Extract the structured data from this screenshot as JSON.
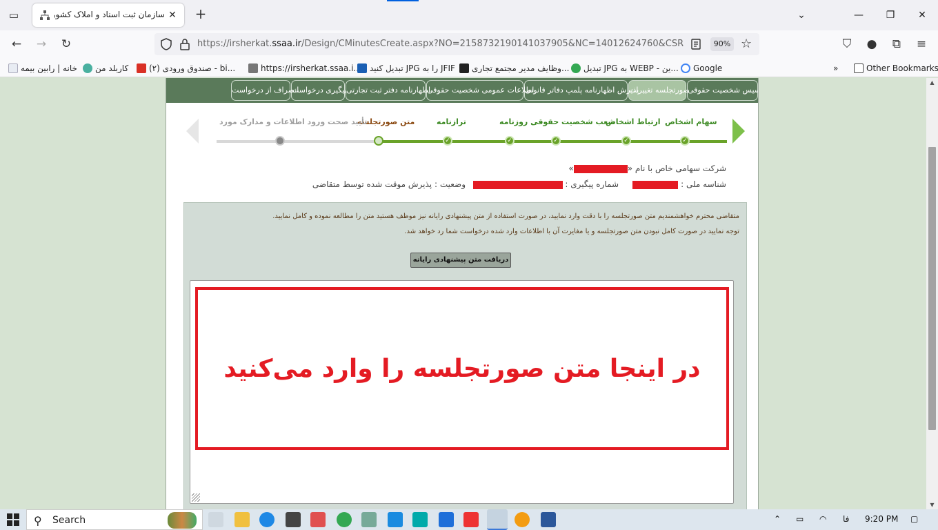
{
  "browser": {
    "tab_title": "سازمان ثبت اسناد و املاک کشور",
    "url_prefix": "https://irsherkat.",
    "url_domain": "ssaa.ir",
    "url_rest": "/Design/CMinutesCreate.aspx?NO=2158732190141037905&NC=14012624760&CSRF=0a",
    "zoom": "90%",
    "bookmarks": [
      "خانه | رابین بیمه",
      "کاربلد من",
      "(۲) صندوق ورودی - bi...",
      "https://irsherkat.ssaa.i...",
      "تبدیل کنید JPG را به JFIF",
      "وظایف مدیر مجتمع تجاری...",
      "تبدیل JPG به WEBP - ین...",
      "Google"
    ],
    "other_bookmarks": "Other Bookmarks"
  },
  "menu": [
    "تأسیس شخصیت حقوقی",
    "صورتجلسه تغییرات",
    "پذیرش اظهارنامه پلمپ دفاتر قانونی",
    "اطلاعات عمومی شخصیت حقوقی",
    "اظهارنامه دفتر ثبت تجارتی",
    "پیگیری درخواست",
    "انصراف از درخواست"
  ],
  "steps": [
    {
      "label": "سهام اشخاص",
      "state": "done"
    },
    {
      "label": "ارتباط اشخاص",
      "state": "done"
    },
    {
      "label": "شعب شخصیت حقوقی روزنامه",
      "state": "done"
    },
    {
      "label": "ترازنامه",
      "state": "done"
    },
    {
      "label": "متن صورتجلسه",
      "state": "current"
    },
    {
      "label": "تأیید صحت ورود اطلاعات و مدارک مورد",
      "state": "todo"
    }
  ],
  "company": {
    "prefix": "شرکت سهامی خاص با نام «",
    "suffix": "»",
    "national_id_label": "شناسه ملی :",
    "tracking_label": "شماره پیگیری :",
    "status": "وضعیت : پذیرش موقت شده توسط متقاضی"
  },
  "panel": {
    "note1": "متقاضی محترم خواهشمندیم متن صورتجلسه را با دقت وارد نمایید، در صورت استفاده از متن پیشنهادی رایانه نیز موظف هستید متن را مطالعه نموده و کامل نمایید.",
    "note2": "توجه نمایید در صورت کامل نبودن متن صورتجلسه و یا مغایرت آن با اطلاعات وارد شده درخواست شما رد خواهد شد.",
    "fetch_button": "دریافت متن پیشنهادی رایانه",
    "callout": "در اینجا متن صورتجلسه را وارد می‌کنید"
  },
  "taskbar": {
    "search": "Search",
    "lang": "فا",
    "time": "9:20 PM"
  }
}
